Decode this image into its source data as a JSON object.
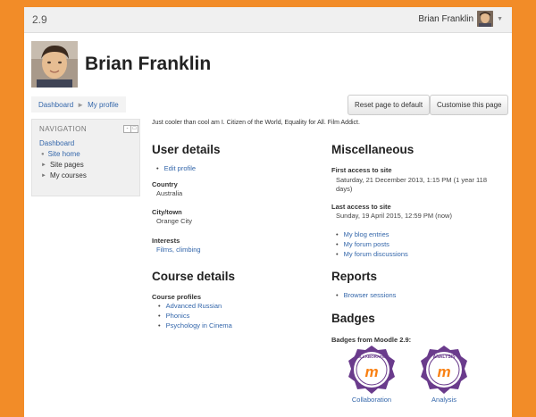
{
  "header": {
    "brand": "2.9",
    "username": "Brian Franklin"
  },
  "profile": {
    "name": "Brian Franklin",
    "description": "Just cooler than cool am I. Citizen of the World, Equality for All. Film Addict."
  },
  "breadcrumb": [
    "Dashboard",
    "My profile"
  ],
  "buttons": {
    "reset": "Reset page to default",
    "customise": "Customise this page"
  },
  "navigation": {
    "title": "NAVIGATION",
    "dashboard": "Dashboard",
    "items": [
      "Site home",
      "Site pages",
      "My courses"
    ]
  },
  "user_details": {
    "heading": "User details",
    "edit_profile": "Edit profile",
    "country_label": "Country",
    "country": "Australia",
    "city_label": "City/town",
    "city": "Orange City",
    "interests_label": "Interests",
    "interests": "Films, climbing"
  },
  "course_details": {
    "heading": "Course details",
    "profiles_label": "Course profiles",
    "courses": [
      "Advanced Russian",
      "Phonics",
      "Psychology in Cinema"
    ]
  },
  "misc": {
    "heading": "Miscellaneous",
    "first_access_label": "First access to site",
    "first_access_line1": "Saturday, 21 December 2013, 1:15 PM  (1 year 118",
    "first_access_line2": "days)",
    "last_access_label": "Last access to site",
    "last_access": "Sunday, 19 April 2015, 12:59 PM  (now)",
    "links": [
      "My blog entries",
      "My forum posts",
      "My forum discussions"
    ]
  },
  "reports": {
    "heading": "Reports",
    "links": [
      "Browser sessions"
    ]
  },
  "badges": {
    "heading": "Badges",
    "from_label": "Badges from Moodle 2.9:",
    "items": [
      {
        "name": "Collaboration",
        "ring_text": "COLLABORATION",
        "color": "#6a3b8c"
      },
      {
        "name": "Analysis",
        "ring_text": "ANALYSIS",
        "color": "#6a3b8c"
      }
    ]
  },
  "colors": {
    "accent": "#f28c28",
    "link": "#3366aa",
    "moodle_orange": "#f98012"
  }
}
